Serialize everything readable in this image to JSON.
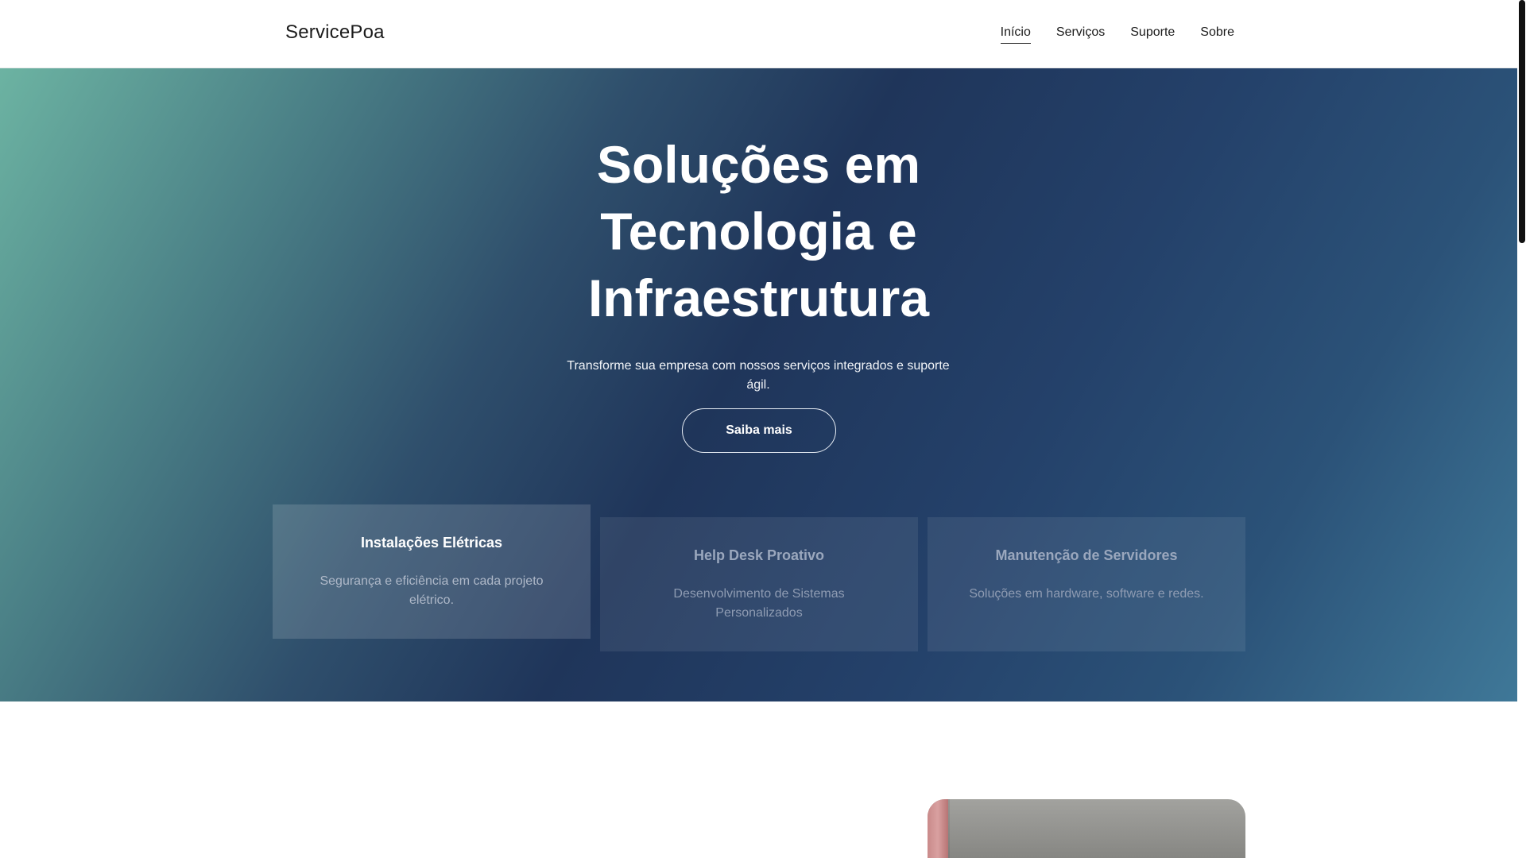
{
  "header": {
    "brand": "ServicePoa",
    "nav": [
      {
        "label": "Início",
        "active": true
      },
      {
        "label": "Serviços",
        "active": false
      },
      {
        "label": "Suporte",
        "active": false
      },
      {
        "label": "Sobre",
        "active": false
      }
    ]
  },
  "hero": {
    "title_lines": [
      "Soluções em",
      "Tecnologia e",
      "Infraestrutura"
    ],
    "subtitle": "Transforme sua empresa com nossos serviços integrados e suporte ágil.",
    "button_label": "Saiba mais"
  },
  "cards": [
    {
      "title": "Instalações Elétricas",
      "text": "Segurança e eficiência em cada projeto elétrico."
    },
    {
      "title": "Help Desk Proativo",
      "text": "Desenvolvimento de Sistemas Personalizados"
    },
    {
      "title": "Manutenção de Servidores",
      "text": "Soluções em hardware, software e redes."
    }
  ],
  "colors": {
    "hero_gradient": [
      "#6cb3a2",
      "#1f355a",
      "#3f7898"
    ],
    "text_dark": "#1b1b1b",
    "white": "#ffffff"
  }
}
